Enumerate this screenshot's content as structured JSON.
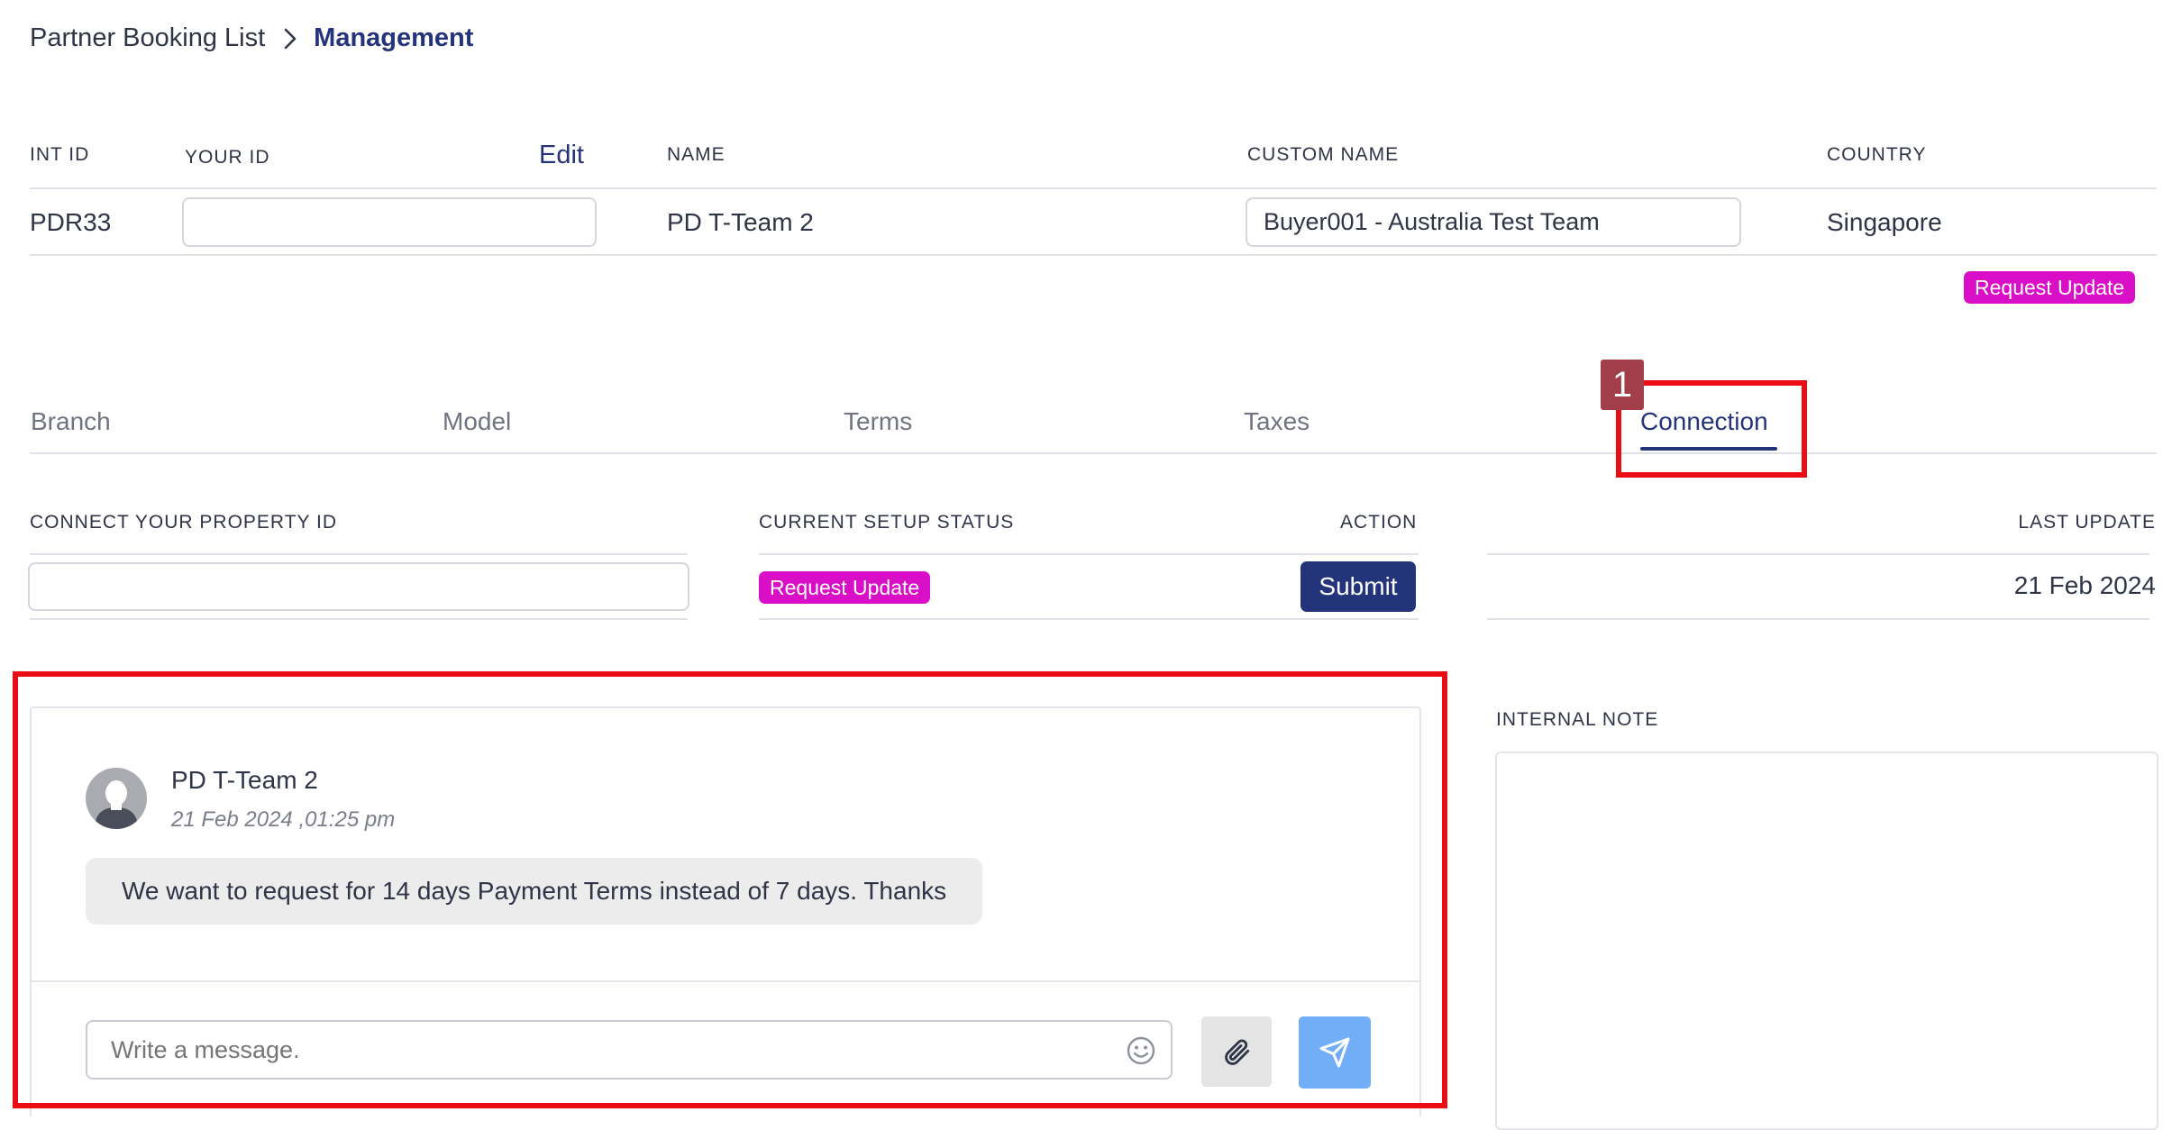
{
  "breadcrumb": {
    "parent": "Partner Booking List",
    "current": "Management"
  },
  "table": {
    "headers": {
      "int_id": "INT ID",
      "your_id": "YOUR ID",
      "edit": "Edit",
      "name": "NAME",
      "custom_name": "CUSTOM NAME",
      "country": "COUNTRY"
    },
    "row": {
      "int_id": "PDR33",
      "your_id": "",
      "name": "PD T-Team 2",
      "custom_name": "Buyer001 - Australia Test Team",
      "country": "Singapore"
    },
    "request_update": "Request Update"
  },
  "tabs": [
    {
      "label": "Branch"
    },
    {
      "label": "Model"
    },
    {
      "label": "Terms"
    },
    {
      "label": "Taxes"
    },
    {
      "label": "Connection"
    }
  ],
  "annotation_number": "1",
  "connection": {
    "headers": {
      "property_id": "CONNECT YOUR PROPERTY ID",
      "status": "CURRENT SETUP STATUS",
      "action": "ACTION",
      "last_update": "LAST UPDATE"
    },
    "property_id_value": "",
    "status_badge": "Request Update",
    "submit_label": "Submit",
    "last_update": "21 Feb 2024"
  },
  "chat": {
    "sender": "PD T-Team 2",
    "timestamp": "21 Feb 2024 ,01:25 pm",
    "message": "We want to request for 14 days Payment Terms instead of 7 days. Thanks",
    "input_placeholder": "Write a message."
  },
  "internal_note": {
    "label": "INTERNAL NOTE"
  },
  "colors": {
    "accent": "#24347a",
    "badge": "#d80fc6",
    "highlight": "#ea0d13",
    "send_button": "#72aef8",
    "chip": "#a23e48"
  }
}
